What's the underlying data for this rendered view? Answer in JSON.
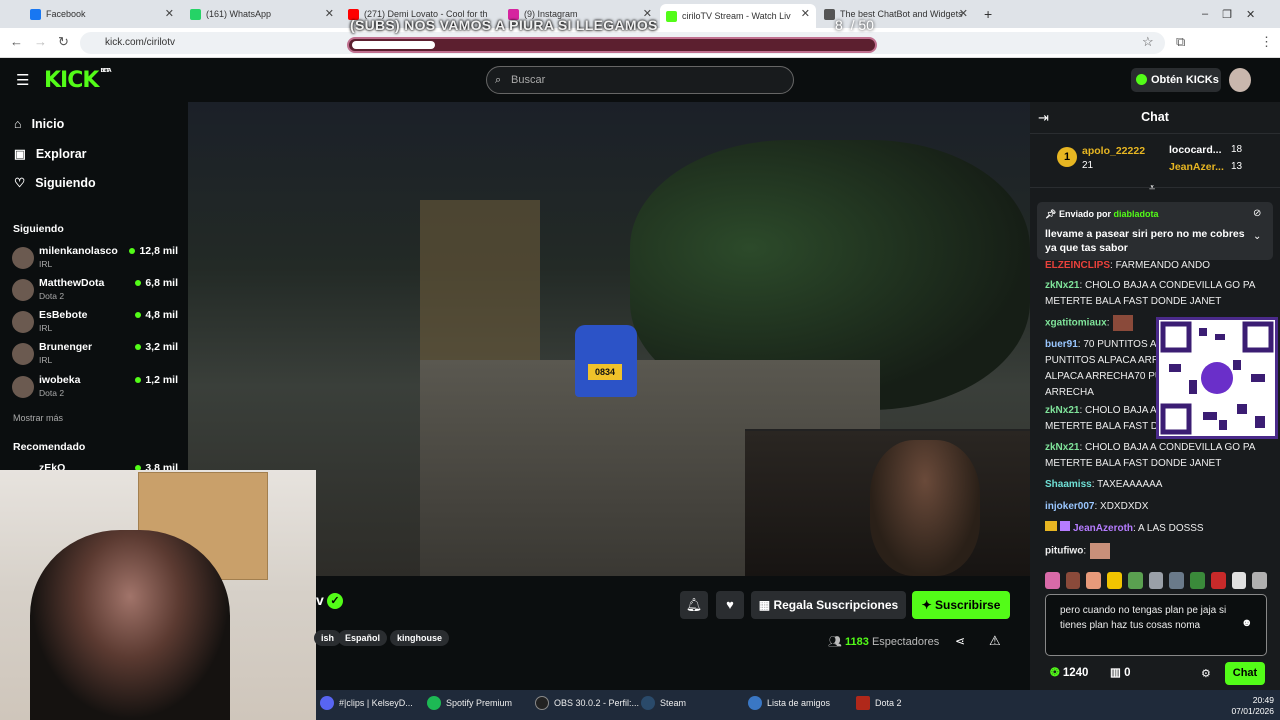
{
  "browser": {
    "tabs": [
      {
        "label": "Facebook",
        "color": "#1877f2"
      },
      {
        "label": "(161) WhatsApp",
        "color": "#25d366"
      },
      {
        "label": "(271) Demi Lovato - Cool for th",
        "color": "#ff0000"
      },
      {
        "label": "(9) Instagram",
        "color": "#d6249f"
      },
      {
        "label": "ciriloTV Stream - Watch Liv",
        "color": "#53fc18"
      },
      {
        "label": "The best ChatBot and Widgets",
        "color": "#555555"
      }
    ],
    "url": "kick.com/cirilotv"
  },
  "overlay": {
    "goal_text": "(SUBS) NOS VAMOS A PIURA SI LLEGAMOS",
    "current": "8",
    "sep": "/",
    "target": "50",
    "progress": 0.16
  },
  "header": {
    "logo": "KICK",
    "logo_sup": "BETA",
    "search_placeholder": "Buscar",
    "kicks_button": "Obtén KICKs"
  },
  "sidebar": {
    "nav": [
      {
        "label": "Inicio",
        "icon": "home-icon"
      },
      {
        "label": "Explorar",
        "icon": "explore-icon"
      },
      {
        "label": "Siguiendo",
        "icon": "heart-icon"
      }
    ],
    "following_title": "Siguiendo",
    "following": [
      {
        "name": "milenkanolasco",
        "category": "IRL",
        "viewers": "12,8 mil"
      },
      {
        "name": "MatthewDota",
        "category": "Dota 2",
        "viewers": "6,8 mil"
      },
      {
        "name": "EsBebote",
        "category": "IRL",
        "viewers": "4,8 mil"
      },
      {
        "name": "Brunenger",
        "category": "IRL",
        "viewers": "3,2 mil"
      },
      {
        "name": "iwobeka",
        "category": "Dota 2",
        "viewers": "1,2 mil"
      }
    ],
    "show_more": "Mostrar más",
    "recommended_title": "Recomendado",
    "recommended_first": {
      "name": "zEkO",
      "viewers": "3,8 mil"
    }
  },
  "video": {
    "plate": "0834"
  },
  "stream_info": {
    "title_fragment": "v",
    "tags": [
      "ish",
      "Español",
      "kinghouse"
    ],
    "gift_label": "Regala Suscripciones",
    "subscribe_label": "Suscribirse",
    "viewers_count": "1183",
    "viewers_label": "Espectadores"
  },
  "chat": {
    "title": "Chat",
    "leaderboard": [
      {
        "rank": "1",
        "name": "apolo_22222",
        "count": "21"
      },
      {
        "name": "lococard...",
        "count": "18"
      },
      {
        "name": "JeanAzer...",
        "count": "13"
      }
    ],
    "pinned": {
      "sent_by_label": "Enviado por",
      "sender": "diabladota",
      "text": "llevame a pasear siri pero no me cobres ya que tas sabor"
    },
    "messages": [
      {
        "user": "ELZEINCLIPS",
        "text": ": FARMEANDO ANDO",
        "color": "#e9413b"
      },
      {
        "user": "zkNx21",
        "text": ": CHOLO BAJA A CONDEVILLA GO PA METERTE BALA FAST DONDE JANET",
        "color": "#7fe39a"
      },
      {
        "user": "xgatitomiaux",
        "text": ":",
        "color": "#7fe39a"
      },
      {
        "user": "buer91",
        "text": ": 70 PUNTITOS ALPACA ARRECHA70 PUNTITOS ALPACA ARRECHA70 PUNTITOS ALPACA ARRECHA70 PUNTITOS ALPACA ARRECHA",
        "color": "#9ac7ff"
      },
      {
        "user": "zkNx21",
        "text": ": CHOLO BAJA A CONDEVILLA GO PA METERTE BALA FAST DONDE JANET",
        "color": "#7fe39a"
      },
      {
        "user": "zkNx21",
        "text": ": CHOLO BAJA A CONDEVILLA GO PA METERTE BALA FAST DONDE JANET",
        "color": "#7fe39a"
      },
      {
        "user": "Shaamiss",
        "text": ": TAXEAAAAAA",
        "color": "#6fe0d6"
      },
      {
        "user": "injoker007",
        "text": ": XDXDXDX",
        "color": "#9ac7ff"
      },
      {
        "user": "JeanAzeroth",
        "text": ": A LAS DOSSS",
        "color": "#b57cff"
      },
      {
        "user": "pitufiwo",
        "text": ":",
        "color": "#ffffff"
      }
    ],
    "input_text": "pero cuando no tengas plan pe jaja si tienes plan haz tus cosas noma",
    "kicks_balance": "1240",
    "bits_balance": "0",
    "send_label": "Chat"
  },
  "taskbar": {
    "items": [
      {
        "label": "#|clips | KelseyD...",
        "color": "#5865f2"
      },
      {
        "label": "Spotify Premium",
        "color": "#1db954"
      },
      {
        "label": "OBS 30.0.2 - Perfil:...",
        "color": "#222222"
      },
      {
        "label": "Steam",
        "color": "#1b2838"
      },
      {
        "label": "Lista de amigos",
        "color": "#3a77c4"
      },
      {
        "label": "Dota 2",
        "color": "#b0281a"
      }
    ],
    "time": "20:49",
    "date": "07/01/2026"
  },
  "colors": {
    "brand": "#53fc18",
    "chat_bg": "#181b1d",
    "page_bg": "#0b0e0f"
  }
}
